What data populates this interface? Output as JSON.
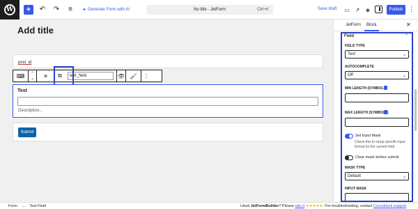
{
  "topbar": {
    "generate_label": "Generate Form with AI",
    "doc_title": "No title · JetForm",
    "shortcut": "Ctrl+K",
    "save_draft": "Save draft",
    "publish": "Publish"
  },
  "editor": {
    "title_placeholder": "Add title",
    "post_id": "post_id",
    "toolbar_field_name": "text_field",
    "field_label": "Text",
    "field_description": "Description...",
    "submit_label": "Submit"
  },
  "sidebar": {
    "tabs": [
      {
        "label": "JetForm"
      },
      {
        "label": "Block"
      }
    ],
    "active_tab": "Block",
    "panel_title": "Field",
    "field_type_label": "FIELD TYPE",
    "field_type_value": "Text",
    "autocomplete_label": "AUTOCOMPLETE",
    "autocomplete_value": "Off",
    "min_length_label": "MIN LENGTH (SYMBOLS)",
    "max_length_label": "MAX LENGTH (SYMBOLS)",
    "set_input_mask_label": "Set Input Mask",
    "set_input_mask_on": true,
    "set_input_mask_help": "Check this to setup specific input format for the current field",
    "clear_mask_label": "Clear mask before submit",
    "clear_mask_on": false,
    "mask_type_label": "MASK TYPE",
    "mask_type_value": "Default",
    "input_mask_label": "INPUT MASK"
  },
  "footer": {
    "crumb_1": "Form",
    "crumb_2": "Text Field",
    "liked_prefix": "Liked ",
    "liked_product": "JetFormBuilder",
    "liked_mid": "? Please ",
    "rate_link": "rate it",
    "stars": "★★★★★",
    "troubleshoot": ". For troubleshooting, contact ",
    "support_link": "Crocoblock support"
  },
  "colors": {
    "accent": "#3858e9",
    "highlight": "#2741c7",
    "submit": "#0a62a8"
  }
}
